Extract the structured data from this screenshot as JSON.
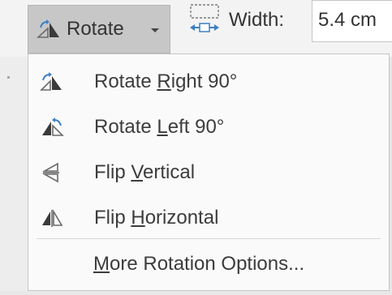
{
  "ribbon": {
    "rotate_button": {
      "label": "Rotate",
      "icon": "rotate-objects-icon",
      "has_dropdown": true
    },
    "width": {
      "icon": "shape-width-icon",
      "label": "Width:",
      "value": "5.4 cm"
    }
  },
  "menu": {
    "items": [
      {
        "id": "rotate-right",
        "pre": "Rotate ",
        "key": "R",
        "post": "ight 90°",
        "icon": "rotate-right-icon"
      },
      {
        "id": "rotate-left",
        "pre": "Rotate ",
        "key": "L",
        "post": "eft 90°",
        "icon": "rotate-left-icon"
      },
      {
        "id": "flip-vertical",
        "pre": "Flip ",
        "key": "V",
        "post": "ertical",
        "icon": "flip-vertical-icon"
      },
      {
        "id": "flip-horizontal",
        "pre": "Flip ",
        "key": "H",
        "post": "orizontal",
        "icon": "flip-horizontal-icon"
      }
    ],
    "more": {
      "pre": "",
      "key": "M",
      "post": "ore Rotation Options..."
    }
  },
  "colors": {
    "icon_dark": "#3a3a3a",
    "icon_arrow": "#3d7fc4",
    "menu_bg": "#fafafa",
    "button_pressed": "#c7c7c7"
  }
}
